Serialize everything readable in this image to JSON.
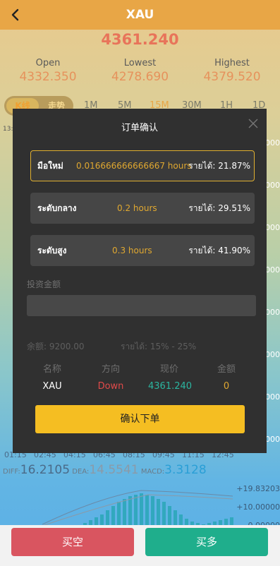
{
  "header": {
    "title": "XAU",
    "price": "4361.240"
  },
  "stats": [
    {
      "label": "Open",
      "value": "4332.350"
    },
    {
      "label": "Lowest",
      "value": "4278.690"
    },
    {
      "label": "Highest",
      "value": "4379.520"
    }
  ],
  "chart_tabs": {
    "kline": "K线",
    "trend": "走势",
    "timeframes": [
      "1M",
      "5M",
      "15M",
      "30M",
      "1H",
      "1D"
    ],
    "active_timeframe": "15M"
  },
  "chart_time_label": "13:",
  "chart_right_ticks": [
    "2000",
    "000",
    "000",
    "000",
    "000",
    "000",
    "000",
    "000",
    "000"
  ],
  "x_axis_times": [
    "01:15",
    "02:45",
    "04:15",
    "06:45",
    "08:15",
    "09:45",
    "11:15",
    "12:45"
  ],
  "macd": {
    "diff_label": "DIFF:",
    "diff_value": "16.2105",
    "dea_label": "DEA:",
    "dea_value": "14.5541",
    "macd_label": "MACD:",
    "macd_value": "3.3128",
    "ticks": [
      "+19.83203",
      "+10.00000",
      "-0.00000"
    ]
  },
  "bottom": {
    "short_label": "买空",
    "long_label": "买多"
  },
  "modal": {
    "title": "订单确认",
    "options": [
      {
        "label": "มือใหม่",
        "duration": "0.016666666666667 hours",
        "yield": "รายได้: 21.87%",
        "selected": true
      },
      {
        "label": "ระดับกลาง",
        "duration": "0.2 hours",
        "yield": "รายได้: 29.51%",
        "selected": false
      },
      {
        "label": "ระดับสูง",
        "duration": "0.3 hours",
        "yield": "รายได้: 41.90%",
        "selected": false
      }
    ],
    "investment_label": "投资金额",
    "investment_value": "",
    "balance": "余额: 9200.00",
    "income_range": "รายได้:  15% - 25%",
    "table_headers": [
      "名称",
      "方向",
      "现价",
      "金额"
    ],
    "table_row": {
      "name": "XAU",
      "direction": "Down",
      "price": "4361.240",
      "amount": "0"
    },
    "confirm_label": "确认下单",
    "colors": {
      "down": "#e04a4a",
      "price": "#2bb5a0",
      "amount": "#e0a830",
      "accent": "#f5be22"
    }
  }
}
